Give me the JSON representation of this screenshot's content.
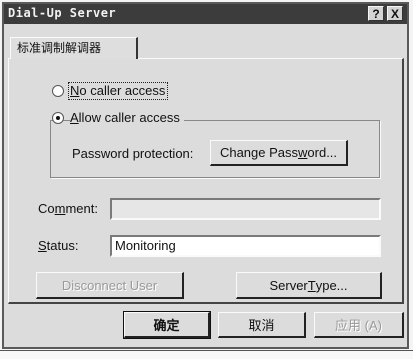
{
  "window": {
    "title": "Dial-Up Server",
    "help_button": "?",
    "close_button": "X"
  },
  "tabs": [
    {
      "label": "标准调制解调器"
    }
  ],
  "access": {
    "no_access_pre": "N",
    "no_access_rest": "o caller access",
    "allow_access_pre": "A",
    "allow_access_rest": "llow caller access",
    "selected": "allow"
  },
  "password": {
    "label": "Password protection:",
    "button_pre": "Change Pass",
    "button_u": "w",
    "button_post": "ord..."
  },
  "comment": {
    "label_pre": "Co",
    "label_u": "m",
    "label_post": "ment:",
    "value": ""
  },
  "status": {
    "label_pre": "",
    "label_u": "S",
    "label_post": "tatus:",
    "value": "Monitoring"
  },
  "buttons": {
    "disconnect": "Disconnect User",
    "server_type_pre": "Server ",
    "server_type_u": "T",
    "server_type_post": "ype..."
  },
  "footer": {
    "ok": "确定",
    "cancel": "取消",
    "apply": "应用 (A)"
  }
}
